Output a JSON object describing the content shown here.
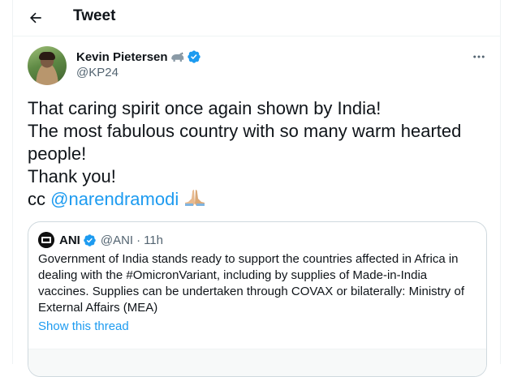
{
  "header": {
    "title": "Tweet",
    "back_icon": "arrow-left-icon"
  },
  "tweet": {
    "author": {
      "display_name": "Kevin Pietersen",
      "name_emoji": "rhino-emoji-icon",
      "handle": "@KP24",
      "verified_icon": "verified-badge-icon"
    },
    "more_icon": "more-horizontal-icon",
    "text_lines": [
      "That caring spirit once again shown by India!",
      "The most fabulous country with so many warm hearted",
      "people!",
      "Thank you!"
    ],
    "cc_prefix": "cc ",
    "mention": "@narendramodi",
    "emoji": "folded-hands-emoji-icon"
  },
  "quote": {
    "name": "ANI",
    "handle": "@ANI",
    "separator": "·",
    "time": "11h",
    "body_lines": [
      "Government of India stands ready to support the countries affected in Africa in",
      "dealing with the #OmicronVariant, including by supplies of Made-in-India",
      "vaccines. Supplies can be undertaken through COVAX or bilaterally: Ministry of",
      "External Affairs (MEA)"
    ],
    "show_thread": "Show this thread"
  },
  "colors": {
    "link": "#1d9bf0",
    "text": "#0f1419",
    "secondary": "#536471",
    "border": "#cfd9de"
  }
}
